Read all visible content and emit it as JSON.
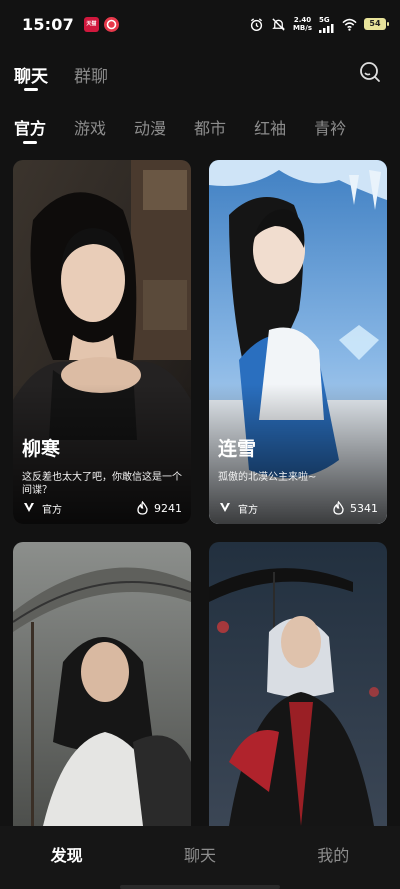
{
  "status_bar": {
    "time": "15:07",
    "badges": [
      "天猫",
      ""
    ],
    "net_speed": "2.40",
    "net_unit": "MB/s",
    "net_type": "5G",
    "battery": "54"
  },
  "top_tabs": [
    {
      "label": "聊天",
      "active": true
    },
    {
      "label": "群聊",
      "active": false
    }
  ],
  "categories": [
    {
      "label": "官方",
      "active": true
    },
    {
      "label": "游戏",
      "active": false
    },
    {
      "label": "动漫",
      "active": false
    },
    {
      "label": "都市",
      "active": false
    },
    {
      "label": "红袖",
      "active": false
    },
    {
      "label": "青衿",
      "active": false
    }
  ],
  "cards": [
    {
      "name": "柳寒",
      "desc": "这反差也太大了吧，你敢信这是一个间谍？",
      "badge": "官方",
      "heat": "9241"
    },
    {
      "name": "连雪",
      "desc": "孤傲的北漠公主来啦~",
      "badge": "官方",
      "heat": "5341"
    },
    {
      "name": "",
      "desc": "",
      "badge": "",
      "heat": ""
    },
    {
      "name": "",
      "desc": "",
      "badge": "",
      "heat": ""
    }
  ],
  "bottom_nav": [
    {
      "label": "发现",
      "active": true
    },
    {
      "label": "聊天",
      "active": false
    },
    {
      "label": "我的",
      "active": false
    }
  ],
  "icons": {
    "search": "search-icon",
    "official": "official-logo-icon",
    "heat": "flame-icon"
  }
}
